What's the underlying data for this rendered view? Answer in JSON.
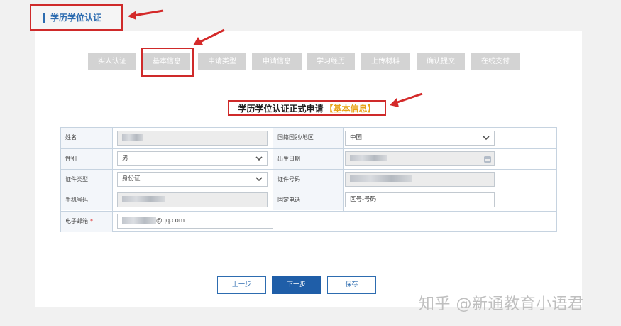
{
  "header": {
    "title": "学历学位认证"
  },
  "steps": [
    "实人认证",
    "基本信息",
    "申请类型",
    "申请信息",
    "学习经历",
    "上传材料",
    "确认提交",
    "在线支付"
  ],
  "form": {
    "title": "学历学位认证正式申请",
    "title_tag": "【基本信息】",
    "labels": {
      "name": "姓名",
      "nationality": "国籍国别/地区",
      "gender": "性别",
      "birthdate": "出生日期",
      "id_type": "证件类型",
      "id_number": "证件号码",
      "mobile": "手机号码",
      "landline": "固定电话",
      "email": "电子邮箱",
      "required_mark": "*"
    },
    "values": {
      "nationality": "中国",
      "gender": "男",
      "id_type": "身份证",
      "landline": "区号-号码",
      "email_suffix": "@qq.com"
    }
  },
  "buttons": {
    "prev": "上一步",
    "next": "下一步",
    "save": "保存"
  },
  "watermark": "知乎 @新通教育小语君",
  "colors": {
    "annotation": "#cf2a2a",
    "accent": "#2d6cb0",
    "tag": "#e8a317"
  }
}
